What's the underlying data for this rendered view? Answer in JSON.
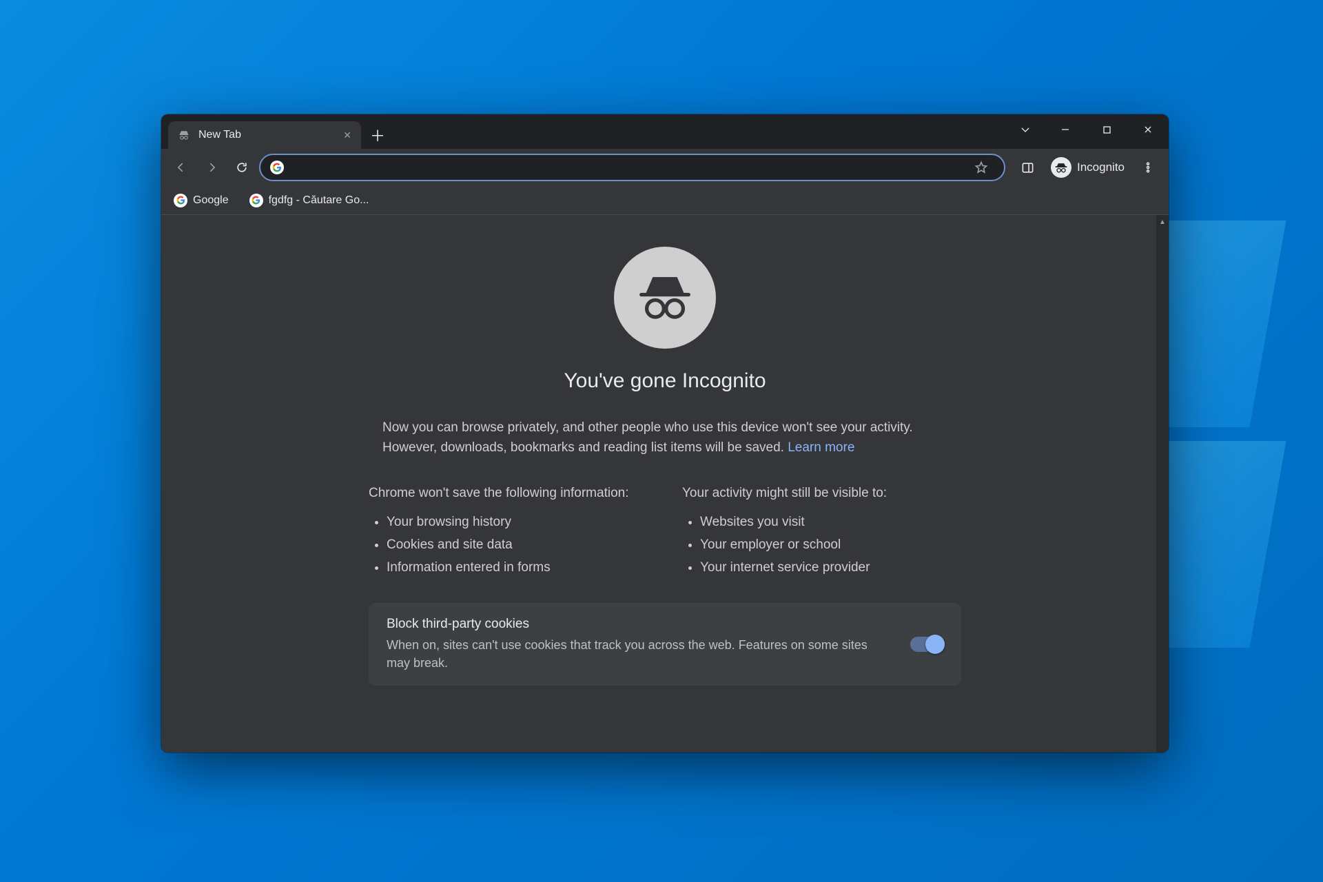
{
  "tab": {
    "title": "New Tab"
  },
  "toolbar": {
    "omnibox_value": "",
    "incognito_chip": "Incognito"
  },
  "bookmarks": [
    {
      "label": "Google"
    },
    {
      "label": "fgdfg - Căutare Go..."
    }
  ],
  "page": {
    "headline": "You've gone Incognito",
    "intro_prefix": "Now you can browse privately, and other people who use this device won't see your activity. However, downloads, bookmarks and reading list items will be saved. ",
    "learn_more": "Learn more",
    "left_col_title": "Chrome won't save the following information:",
    "left_items": [
      "Your browsing history",
      "Cookies and site data",
      "Information entered in forms"
    ],
    "right_col_title": "Your activity might still be visible to:",
    "right_items": [
      "Websites you visit",
      "Your employer or school",
      "Your internet service provider"
    ],
    "cookie_title": "Block third-party cookies",
    "cookie_desc": "When on, sites can't use cookies that track you across the web. Features on some sites may break."
  }
}
